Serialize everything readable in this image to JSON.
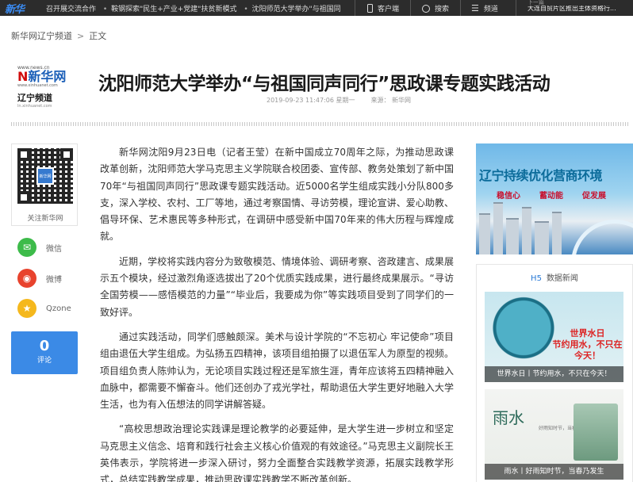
{
  "topbar": {
    "logo": "新华",
    "ticker": [
      "召开展交流合作",
      "鞍钢探索\"民生+产业+党建\"扶贫新模式",
      "沈阳师范大学举办\"与祖国同"
    ],
    "client_label": "客户端",
    "search_label": "搜索",
    "channel_label": "频道",
    "next_label": "下一篇",
    "next_title": "大连自贸片区推出主体资格行..."
  },
  "breadcrumb": {
    "home": "新华网辽宁频道",
    "separator": ">",
    "current": "正文"
  },
  "brand": {
    "url": "www.news.cn",
    "news_text": "新华网",
    "news_sub": "www.xinhuanet.com",
    "region": "辽宁频道",
    "region_url": "ln.xinhuanet.com"
  },
  "article": {
    "title": "沈阳师范大学举办“与祖国同声同行”思政课专题实践活动",
    "datetime": "2019-09-23 11:47:06 星期一",
    "source": "来源：  新华网",
    "paragraphs": [
      "新华网沈阳9月23日电（记者王莹）在新中国成立70周年之际，为推动思政课改革创新，沈阳师范大学马克思主义学院联合校团委、宣传部、教务处策划了新中国70年“与祖国同声同行”思政课专题实践活动。近5000名学生组成实践小分队800多支，深入学校、农村、工厂等地，通过考察国情、寻访劳模，理论宣讲、爱心助教、倡导环保、艺术惠民等多种形式，在调研中感受新中国70年来的伟大历程与辉煌成就。",
      "近期，学校将实践内容分为致敬模范、情境体验、调研考察、咨政建言、成果展示五个模块，经过激烈角逐选拔出了20个优质实践成果，进行最终成果展示。“寻访全国劳模——感悟模范的力量”“毕业后，我要成为你”等实践项目受到了同学们的一致好评。",
      "通过实践活动，同学们感触颇深。美术与设计学院的“不忘初心 牢记使命”项目组由退伍大学生组成。为弘扬五四精神，该项目组拍摄了以退伍军人为原型的视频。项目组负责人陈帅认为，无论项目实践过程还是军旅生涯，青年应该将五四精神融入血脉中，都需要不懈奋斗。他们还创办了戎光学社，帮助退伍大学生更好地融入大学生活，也为有入伍想法的同学讲解答疑。",
      "“高校思想政治理论实践课是理论教学的必要延伸，是大学生进一步树立和坚定马克思主义信念、培育和践行社会主义核心价值观的有效途径。”马克思主义副院长王英伟表示，学院将进一步深入研讨，努力全面整合实践教学资源，拓展实践教学形式，总结实践教学成果，推动思政课实践教学不断改革创新。"
    ]
  },
  "sidebar": {
    "qr_caption": "关注新华网",
    "qr_center": "新华网",
    "share": [
      {
        "label": "微信",
        "icon": "wechat-icon",
        "color": "#3dbb4a",
        "glyph": "✉"
      },
      {
        "label": "微博",
        "icon": "weibo-icon",
        "color": "#e8432d",
        "glyph": "◉"
      },
      {
        "label": "Qzone",
        "icon": "qzone-icon",
        "color": "#f5b81d",
        "glyph": "★"
      }
    ],
    "comment_count": "0",
    "comment_label": "评论"
  },
  "right": {
    "ad_headline": "辽宁持续优化营商环境",
    "ad_slogans": [
      "稳信心",
      "蓄动能",
      "促发展"
    ],
    "panel_prefix": "H5",
    "panel_title": "数据新闻",
    "card1_overlay": [
      "世界水日",
      "节约用水，不只在今天！"
    ],
    "card1_caption": "世界水日丨节约用水，不只在今天！",
    "card2_title": "雨水",
    "card2_sub": "好雨知时节，当春乃发生",
    "card2_caption": "雨水丨好雨知时节，当春乃发生"
  }
}
